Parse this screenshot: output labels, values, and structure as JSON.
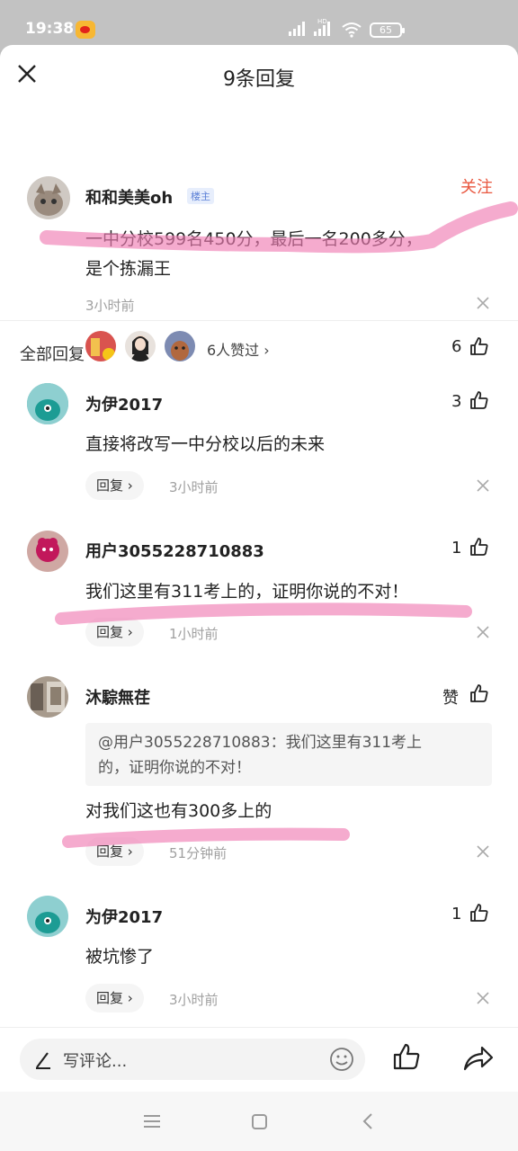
{
  "status_bar": {
    "time": "19:38",
    "battery": "65",
    "network_label": "HD"
  },
  "header": {
    "title": "9条回复"
  },
  "main_comment": {
    "author": "和和美美oh",
    "badge": "楼主",
    "follow_label": "关注",
    "text_line1": "一中分校599名450分，最后一名200多分，",
    "text_line2": "是个拣漏王",
    "time": "3小时前",
    "likers_text": "6人赞过 ›",
    "like_count": "6"
  },
  "section_title": "全部回复",
  "replies": [
    {
      "author": "为伊2017",
      "text": "直接将改写一中分校以后的未来",
      "reply_label": "回复 ›",
      "time": "3小时前",
      "like_count": "3"
    },
    {
      "author": "用户3055228710883",
      "text": "我们这里有311考上的，证明你说的不对！",
      "reply_label": "回复 ›",
      "time": "1小时前",
      "like_count": "1"
    },
    {
      "author": "沐騌無荏",
      "quote_line1": "@用户3055228710883：我们这里有311考上",
      "quote_line2": "的，证明你说的不对！",
      "text": "对我们这也有300多上的",
      "reply_label": "回复 ›",
      "time": "51分钟前",
      "like_count": "赞"
    },
    {
      "author": "为伊2017",
      "text": "被坑惨了",
      "reply_label": "回复 ›",
      "time": "3小时前",
      "like_count": "1"
    }
  ],
  "compose": {
    "placeholder": "写评论..."
  },
  "colors": {
    "accent": "#e9573f",
    "highlight": "#f07eb3",
    "badge_bg": "#e7eefc"
  },
  "icons": [
    "close-icon",
    "like-icon",
    "emoji-icon",
    "share-icon",
    "pen-icon",
    "chevron-right-icon"
  ]
}
